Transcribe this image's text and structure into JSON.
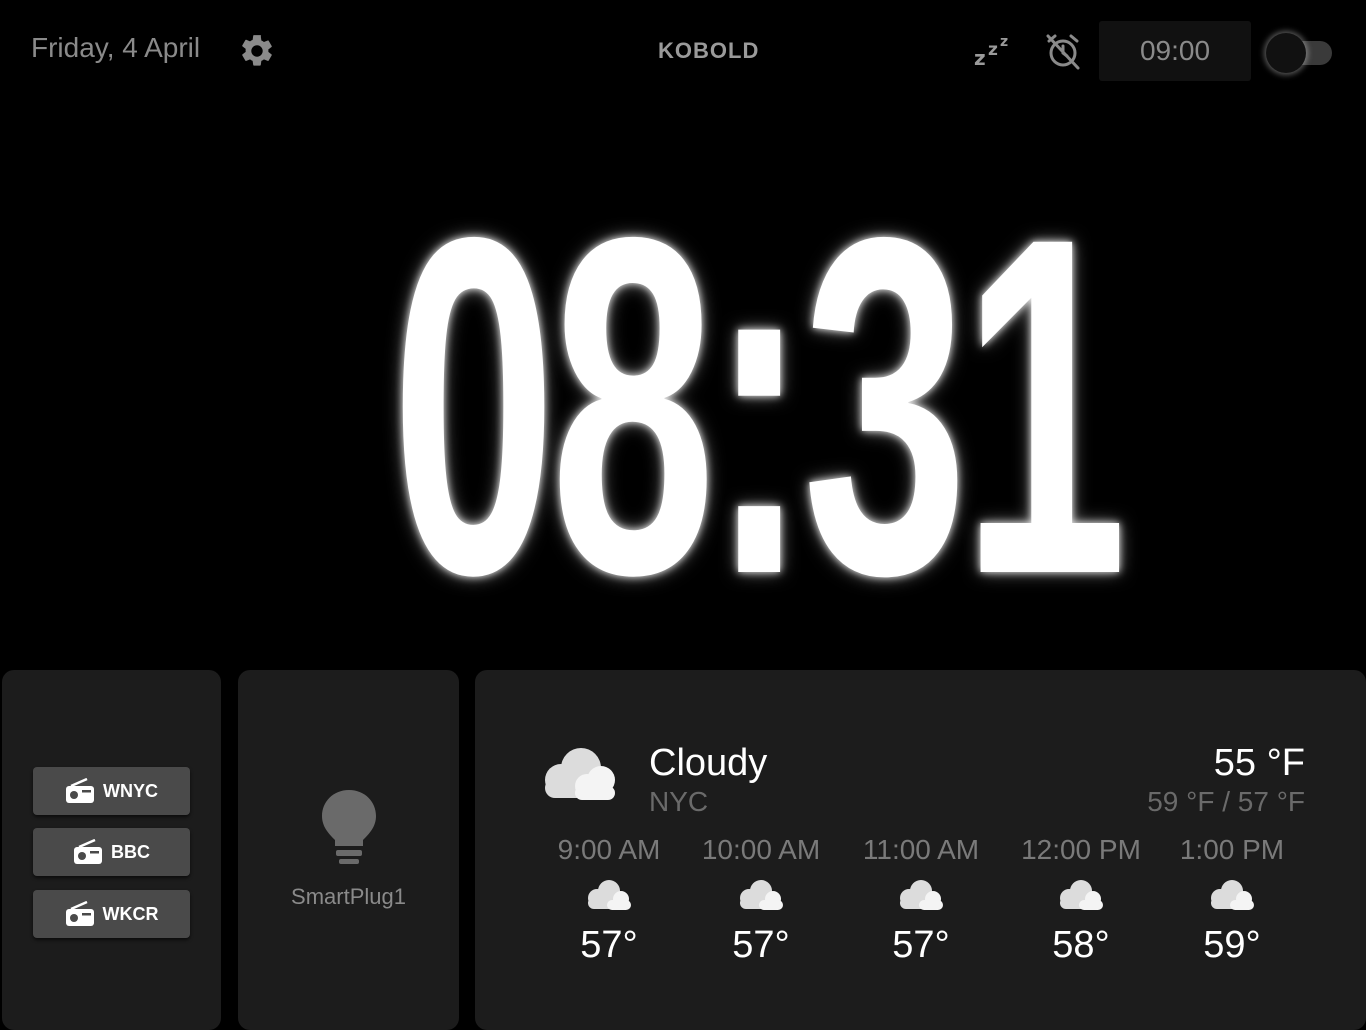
{
  "header": {
    "date": "Friday, 4 April",
    "logo": "KOBOLD",
    "alarm_time": "09:00",
    "icons": {
      "settings": "gear-icon",
      "snooze": "snooze-icon",
      "alarm_off": "alarm-off-icon"
    },
    "toggle_on": false
  },
  "clock": {
    "time": "08:31"
  },
  "radio": {
    "stations": [
      {
        "label": "WNYC",
        "icon": "radio-icon"
      },
      {
        "label": "BBC",
        "icon": "radio-icon"
      },
      {
        "label": "WKCR",
        "icon": "radio-icon"
      }
    ]
  },
  "smartplug": {
    "label": "SmartPlug1",
    "icon": "lightbulb-icon"
  },
  "weather": {
    "condition": "Cloudy",
    "city": "NYC",
    "current_temp": "55 °F",
    "high_low": "59 °F / 57 °F",
    "icon": "cloud-icon",
    "forecast": [
      {
        "time": "9:00 AM",
        "temp": "57°"
      },
      {
        "time": "10:00 AM",
        "temp": "57°"
      },
      {
        "time": "11:00 AM",
        "temp": "57°"
      },
      {
        "time": "12:00 PM",
        "temp": "58°"
      },
      {
        "time": "1:00 PM",
        "temp": "59°"
      }
    ]
  },
  "colors": {
    "background": "#000000",
    "panel": "#1c1c1c",
    "button": "#4a4a4a",
    "muted_text": "#8a8a8a"
  }
}
